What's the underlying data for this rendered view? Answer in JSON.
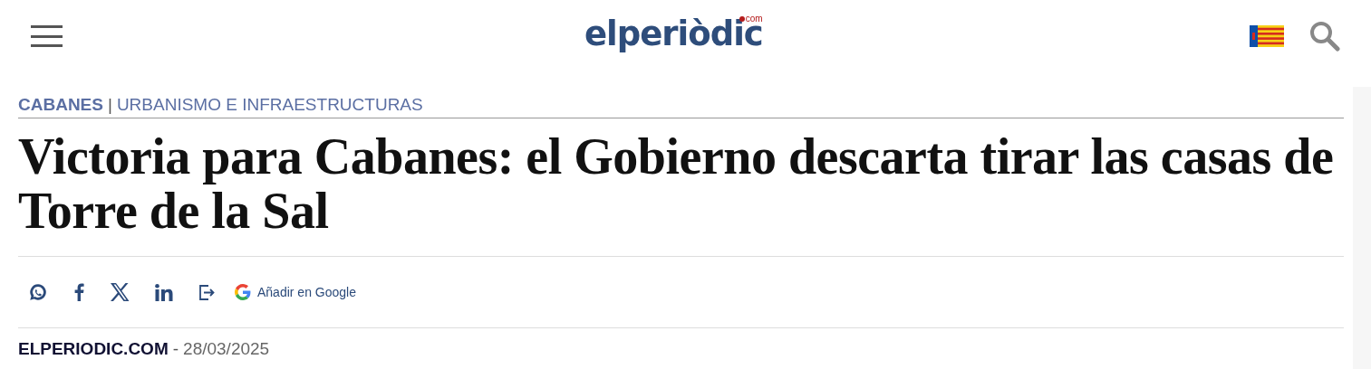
{
  "header": {
    "logo": {
      "name": "elperiòdic",
      "suffix": "com"
    }
  },
  "breadcrumb": {
    "section": "CABANES",
    "separator": "|",
    "topic": "URBANISMO E INFRAESTRUCTURAS"
  },
  "headline": "Victoria para Cabanes: el Gobierno descarta tirar las casas de Torre de la Sal",
  "share": [
    {
      "kind": "whatsapp"
    },
    {
      "kind": "facebook"
    },
    {
      "kind": "x"
    },
    {
      "kind": "linkedin"
    },
    {
      "kind": "share"
    },
    {
      "kind": "google",
      "label": "Añadir en Google"
    }
  ],
  "byline": {
    "author": "ELPERIODIC.COM",
    "separator": "-",
    "date": "28/03/2025"
  }
}
